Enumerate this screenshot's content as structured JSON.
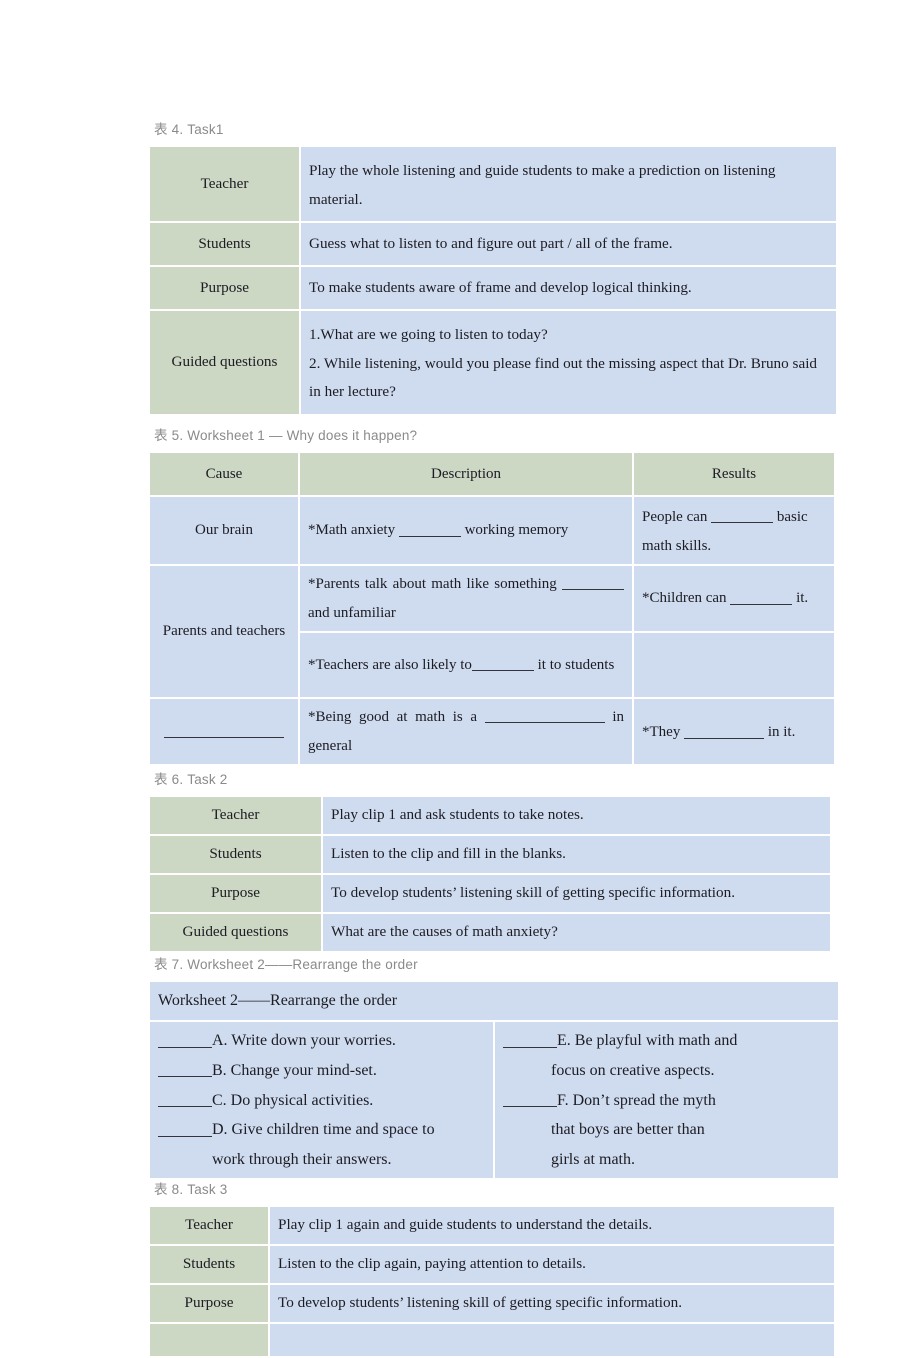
{
  "document": {
    "page_background": "#ffffff",
    "label_cell_color": "#ccd7c4",
    "value_cell_color": "#cfdcf0",
    "caption_color": "#8a8a8a"
  },
  "table4": {
    "caption": "表 4. Task1",
    "rows": [
      {
        "label": "Teacher",
        "value": "Play the whole listening and guide students to make a prediction on listening material."
      },
      {
        "label": "Students",
        "value": "Guess what to listen to and figure out part / all of the frame."
      },
      {
        "label": "Purpose",
        "value": "To make students aware of frame and develop logical thinking."
      },
      {
        "label": "Guided questions",
        "value": ""
      }
    ],
    "guided_questions_lines": [
      "1.What are we going to listen to today?",
      "2. While listening, would you please find out the missing aspect that Dr. Bruno said in her lecture?"
    ]
  },
  "table5": {
    "caption": "表 5. Worksheet 1 — Why does it happen?",
    "headers": [
      "Cause",
      "Description",
      "Results"
    ],
    "causes": [
      {
        "text": "Our brain",
        "blank": false
      },
      {
        "text": "Parents and teachers",
        "blank": false
      },
      {
        "text": "",
        "blank": true
      }
    ],
    "descriptions": [
      {
        "pre": "*Math anxiety ",
        "mid": " working memory",
        "post": ""
      },
      {
        "pre": "*Parents talk about math like something ",
        "mid": " and unfamiliar",
        "post": ""
      },
      {
        "pre": "*Teachers are also likely to",
        "mid": " it to students",
        "post": ""
      },
      {
        "pre": "*Being good at math is a ",
        "mid": " in general",
        "post": ""
      }
    ],
    "results": [
      {
        "pre": "People can ",
        "post": " basic math skills."
      },
      {
        "pre": "*Children can ",
        "post": " it."
      },
      {
        "pre": "",
        "post": ""
      },
      {
        "pre": "*They ",
        "post": " in it."
      }
    ]
  },
  "table6": {
    "caption": "表 6. Task 2",
    "rows": [
      {
        "label": "Teacher",
        "value": "Play clip 1 and ask students to take notes."
      },
      {
        "label": "Students",
        "value": "Listen to the clip and fill in the blanks."
      },
      {
        "label": "Purpose",
        "value": "To develop students’ listening skill of getting specific information."
      },
      {
        "label": "Guided questions",
        "value": "What are the causes of math anxiety?"
      }
    ]
  },
  "table7": {
    "caption": "表 7. Worksheet 2——Rearrange the order",
    "title": "Worksheet 2——Rearrange the order",
    "left_items": [
      {
        "lines": [
          "A. Write down your worries."
        ]
      },
      {
        "lines": [
          "B. Change your mind-set."
        ]
      },
      {
        "lines": [
          "C. Do physical activities."
        ]
      },
      {
        "lines": [
          "D. Give children time and space to",
          "work through their answers."
        ]
      }
    ],
    "right_items": [
      {
        "lines": [
          "E. Be playful with math and",
          "focus on creative aspects."
        ]
      },
      {
        "lines": [
          "F. Don’t spread the myth",
          "that boys are better than",
          "girls at math."
        ]
      }
    ]
  },
  "table8": {
    "caption": "表 8. Task 3",
    "rows": [
      {
        "label": "Teacher",
        "value": "Play clip 1 again and guide students to understand the details."
      },
      {
        "label": "Students",
        "value": "Listen to the clip again, paying attention to details."
      },
      {
        "label": "Purpose",
        "value": "To develop students’ listening skill of getting specific information."
      },
      {
        "label": "",
        "value": ""
      }
    ]
  }
}
